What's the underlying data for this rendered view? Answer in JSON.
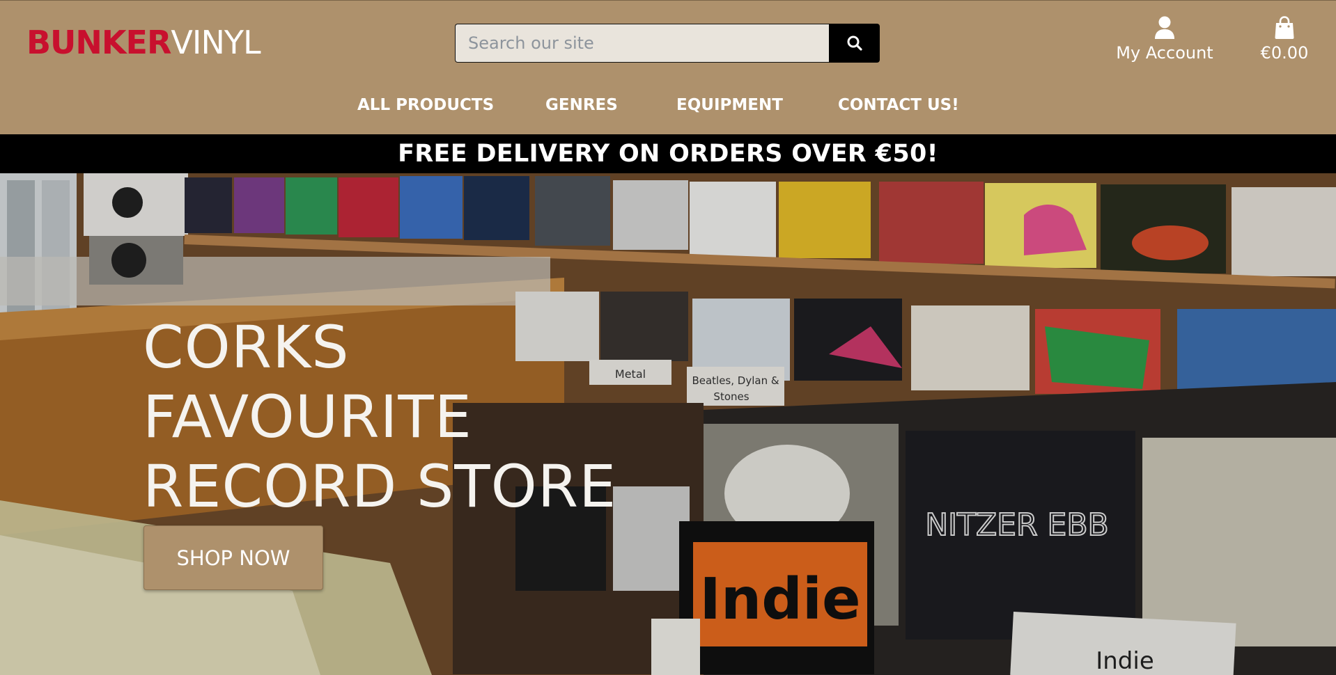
{
  "brand": {
    "logo_part1": "BUNKER",
    "logo_part2": "VINYL",
    "color_primary": "#ae916c",
    "color_logo_red": "#c8102e"
  },
  "search": {
    "placeholder": "Search our site",
    "icon": "search-icon"
  },
  "account": {
    "label": "My Account",
    "icon": "user-icon"
  },
  "bag": {
    "total": "€0.00",
    "icon": "shopping-bag-icon"
  },
  "nav": {
    "items": [
      {
        "label": "ALL PRODUCTS"
      },
      {
        "label": "GENRES"
      },
      {
        "label": "EQUIPMENT"
      },
      {
        "label": "CONTACT US!"
      }
    ]
  },
  "banner": {
    "text": "FREE DELIVERY ON ORDERS OVER €50!"
  },
  "hero": {
    "title_lines": [
      "CORKS",
      "FAVOURITE",
      "RECORD STORE"
    ],
    "button_label": "SHOP NOW",
    "shelf_labels": [
      "Metal",
      "Beatles, Dylan &",
      "Stones",
      "Indie",
      "Indie"
    ]
  }
}
